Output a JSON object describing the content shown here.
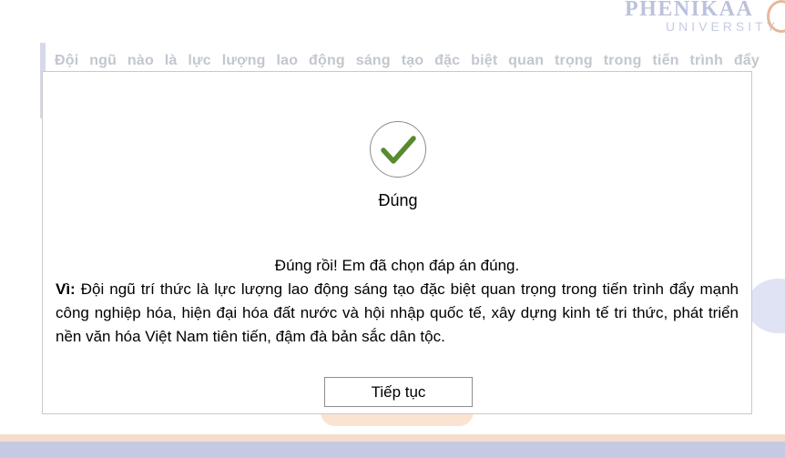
{
  "brand": {
    "name": "PHENIKAA",
    "subtitle": "UNIVERSITY"
  },
  "question": {
    "text": "Đội ngũ nào là lực lượng lao động sáng tạo đặc biệt quan trọng trong tiến trình đẩy"
  },
  "modal": {
    "status_icon": "check-icon",
    "status_color": "#5a8a2f",
    "status_title": "Đúng",
    "feedback_heading": "Đúng rồi! Em đã chọn đáp án đúng.",
    "reason_label": "Vì:",
    "reason_text": " Đội ngũ trí thức là lực lượng lao động sáng tạo đặc biệt quan trọng trong tiến trình đẩy mạnh công nghiệp hóa, hiện đại hóa đất nước và hội nhập quốc tế, xây dựng kinh tế tri thức, phát triển nền văn hóa Việt Nam tiên tiến, đậm đà bản sắc dân tộc.",
    "continue_label": "Tiếp tục"
  }
}
